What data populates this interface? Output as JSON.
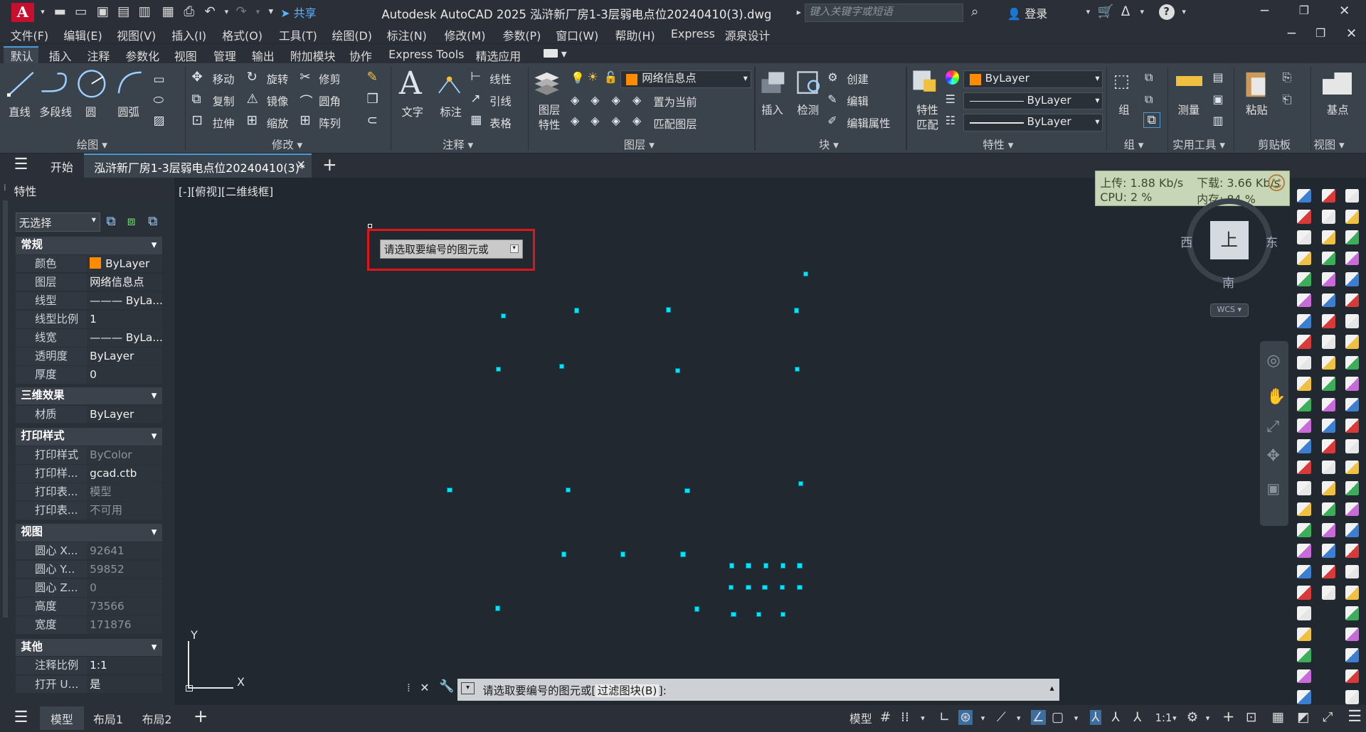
{
  "titlebar": {
    "logo": "A",
    "share_label": "共享",
    "title": "Autodesk AutoCAD 2025    泓浒新厂房1-3层弱电点位20240410(3).dwg",
    "search_placeholder": "键入关键字或短语",
    "login_label": "登录"
  },
  "menubar": {
    "items": [
      "文件(F)",
      "编辑(E)",
      "视图(V)",
      "插入(I)",
      "格式(O)",
      "工具(T)",
      "绘图(D)",
      "标注(N)",
      "修改(M)",
      "参数(P)",
      "窗口(W)",
      "帮助(H)",
      "Express",
      "源泉设计"
    ]
  },
  "ribbon_tabs": {
    "items": [
      "默认",
      "插入",
      "注释",
      "参数化",
      "视图",
      "管理",
      "输出",
      "附加模块",
      "协作",
      "Express Tools",
      "精选应用"
    ]
  },
  "ribbon": {
    "draw": {
      "line": "直线",
      "polyline": "多段线",
      "circle": "圆",
      "arc": "圆弧",
      "panel": "绘图 ▾"
    },
    "modify": {
      "move": "移动",
      "rotate": "旋转",
      "trim": "修剪",
      "copy": "复制",
      "mirror": "镜像",
      "fillet": "圆角",
      "stretch": "拉伸",
      "scale": "缩放",
      "array": "阵列",
      "panel": "修改 ▾"
    },
    "annotation": {
      "text": "文字",
      "dimension": "标注",
      "linear": "线性",
      "leader": "引线",
      "table": "表格",
      "panel": "注释 ▾"
    },
    "layers": {
      "props_line1": "图层",
      "props_line2": "特性",
      "current_layer": "网络信息点",
      "make_current": "置为当前",
      "match_layer": "匹配图层",
      "panel": "图层 ▾"
    },
    "block": {
      "insert": "插入",
      "check": "检测",
      "create": "创建",
      "edit": "编辑",
      "edit_attr": "编辑属性",
      "panel": "块 ▾"
    },
    "properties": {
      "match_line1": "特性",
      "match_line2": "匹配",
      "color": "ByLayer",
      "linetype": "ByLayer",
      "lineweight": "ByLayer",
      "panel": "特性 ▾"
    },
    "groups": {
      "group": "组",
      "panel": "组 ▾"
    },
    "utilities": {
      "measure": "测量",
      "panel": "实用工具 ▾"
    },
    "clipboard": {
      "paste": "粘贴",
      "panel": "剪贴板"
    },
    "view": {
      "base": "基点",
      "panel": "视图 ▾"
    }
  },
  "doctabs": {
    "start": "开始",
    "active": "泓浒新厂房1-3层弱电点位20240410(3)*"
  },
  "properties_panel": {
    "title": "特性",
    "selection": "无选择",
    "sections": {
      "general": "常规",
      "3d": "三维效果",
      "plot": "打印样式",
      "view": "视图",
      "misc": "其他"
    },
    "general_rows": [
      {
        "k": "颜色",
        "v": "ByLayer"
      },
      {
        "k": "图层",
        "v": "网络信息点"
      },
      {
        "k": "线型",
        "v": "——— ByLa..."
      },
      {
        "k": "线型比例",
        "v": "1"
      },
      {
        "k": "线宽",
        "v": "——— ByLa..."
      },
      {
        "k": "透明度",
        "v": "ByLayer"
      },
      {
        "k": "厚度",
        "v": "0"
      }
    ],
    "3d_rows": [
      {
        "k": "材质",
        "v": "ByLayer"
      }
    ],
    "plot_rows": [
      {
        "k": "打印样式",
        "v": "ByColor"
      },
      {
        "k": "打印样...",
        "v": "gcad.ctb"
      },
      {
        "k": "打印表...",
        "v": "模型"
      },
      {
        "k": "打印表...",
        "v": "不可用"
      }
    ],
    "view_rows": [
      {
        "k": "圆心 X...",
        "v": "92641"
      },
      {
        "k": "圆心 Y...",
        "v": "59852"
      },
      {
        "k": "圆心 Z...",
        "v": "0"
      },
      {
        "k": "高度",
        "v": "73566"
      },
      {
        "k": "宽度",
        "v": "171876"
      }
    ],
    "misc_rows": [
      {
        "k": "注释比例",
        "v": "1:1"
      },
      {
        "k": "打开 U...",
        "v": "是"
      }
    ]
  },
  "canvas": {
    "viewport_label": "[-][俯视][二维线框]",
    "tooltip": "请选取要编号的图元或",
    "netmon": {
      "upload": "上传: 1.88 Kb/s",
      "download": "下载: 3.66 Kb/s",
      "cpu": "CPU: 2 %",
      "mem": "内存: 84 %"
    },
    "viewcube": {
      "top": "上",
      "west": "西",
      "east": "东",
      "south": "南",
      "wcs": "WCS"
    },
    "ucs": {
      "x": "X",
      "y": "Y"
    }
  },
  "commandline": {
    "prompt_prefix": "请选取要编号的图元或[",
    "option": "过滤图块(B)",
    "prompt_suffix": "]:"
  },
  "statusbar": {
    "tabs": [
      "模型",
      "布局1",
      "布局2"
    ],
    "model_label": "模型",
    "scale": "1:1"
  },
  "colors": {
    "accent": "#4a9bd8",
    "highlight_box": "#e0151a",
    "point": "#00e5ff",
    "layer_swatch": "#ff8c00"
  }
}
